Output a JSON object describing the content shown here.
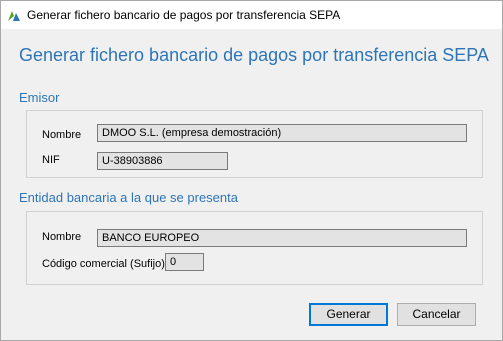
{
  "window": {
    "title": "Generar fichero bancario de pagos por transferencia SEPA"
  },
  "heading": "Generar fichero bancario de pagos por transferencia SEPA",
  "emisor": {
    "section_title": "Emisor",
    "nombre_label": "Nombre",
    "nombre_value": "DMOO S.L. (empresa demostración)",
    "nif_label": "NIF",
    "nif_value": "U-38903886"
  },
  "entidad": {
    "section_title": "Entidad bancaria a la que se presenta",
    "nombre_label": "Nombre",
    "nombre_value": "BANCO EUROPEO",
    "codigo_label": "Código comercial (Sufijo)",
    "codigo_value": "0"
  },
  "buttons": {
    "generar": "Generar",
    "cancelar": "Cancelar"
  },
  "colors": {
    "accent": "#2e75b6",
    "default_button_border": "#0078d7"
  },
  "icons": {
    "app": "app-logo-icon"
  }
}
